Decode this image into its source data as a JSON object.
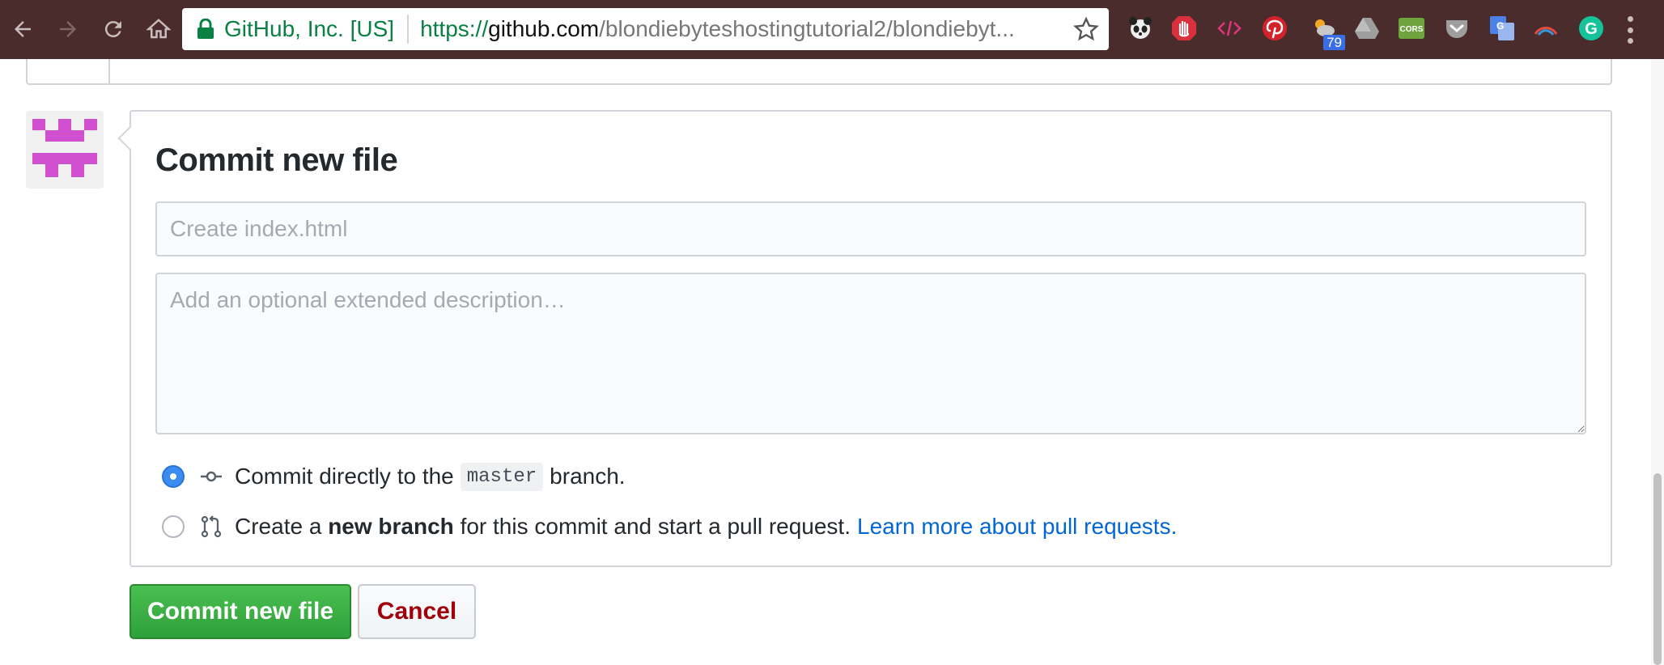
{
  "browser": {
    "site_identity": "GitHub, Inc. [US]",
    "url_scheme": "https://",
    "url_host": "github.com",
    "url_path": "/blondiebyteshostingtutorial2/blondiebyt...",
    "extensions": [
      {
        "name": "panda-extension-icon"
      },
      {
        "name": "adblock-extension-icon"
      },
      {
        "name": "code-extension-icon"
      },
      {
        "name": "pinterest-extension-icon"
      },
      {
        "name": "weather-extension-icon",
        "badge": "79"
      },
      {
        "name": "drive-extension-icon"
      },
      {
        "name": "cors-extension-icon",
        "label": "CORS"
      },
      {
        "name": "pocket-extension-icon"
      },
      {
        "name": "translate-extension-icon"
      },
      {
        "name": "rainbow-extension-icon"
      },
      {
        "name": "grammarly-extension-icon",
        "label": "G"
      }
    ]
  },
  "commit_form": {
    "title": "Commit new file",
    "summary_placeholder": "Create index.html",
    "description_placeholder": "Add an optional extended description…",
    "option_direct": {
      "prefix": "Commit directly to the",
      "branch": "master",
      "suffix": "branch.",
      "checked": true
    },
    "option_new_branch": {
      "prefix": "Create a",
      "bold": "new branch",
      "suffix": "for this commit and start a pull request.",
      "link": "Learn more about pull requests.",
      "checked": false
    }
  },
  "actions": {
    "commit_label": "Commit new file",
    "cancel_label": "Cancel"
  },
  "colors": {
    "chrome_bg": "#4a2c2c",
    "commit_green": "#2ea039",
    "cancel_red": "#a0000a",
    "link_blue": "#0366d6",
    "avatar_magenta": "#d050d0"
  }
}
